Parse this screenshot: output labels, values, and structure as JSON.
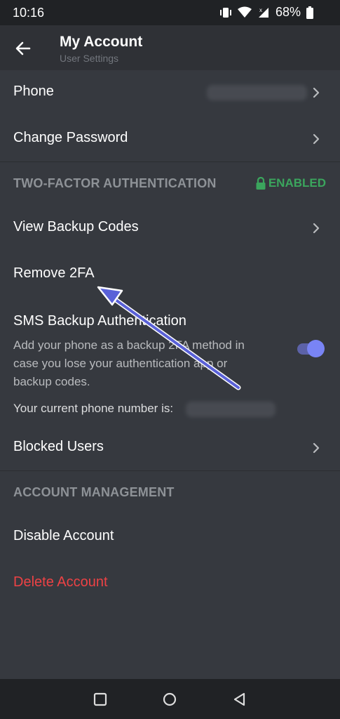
{
  "status_bar": {
    "time": "10:16",
    "battery": "68%",
    "icons": [
      "vibrate-icon",
      "wifi-icon",
      "signal-icon",
      "battery-icon"
    ]
  },
  "header": {
    "title": "My Account",
    "subtitle": "User Settings"
  },
  "account": {
    "phone_label": "Phone",
    "change_password_label": "Change Password"
  },
  "two_factor": {
    "section_title": "TWO-FACTOR AUTHENTICATION",
    "status": "ENABLED",
    "view_backup_codes": "View Backup Codes",
    "remove_2fa": "Remove 2FA",
    "sms_title": "SMS Backup Authentication",
    "sms_description": "Add your phone as a backup 2FA method in case you lose your authentication app or backup codes.",
    "sms_enabled": true,
    "current_phone_label": "Your current phone number is:"
  },
  "privacy": {
    "blocked_users": "Blocked Users"
  },
  "account_management": {
    "section_title": "ACCOUNT MANAGEMENT",
    "disable_account": "Disable Account",
    "delete_account": "Delete Account"
  },
  "colors": {
    "background": "#36393f",
    "header_bg": "#2f3136",
    "enabled_green": "#3ba55d",
    "danger_red": "#ed4245",
    "accent_blurple": "#7984f5"
  }
}
